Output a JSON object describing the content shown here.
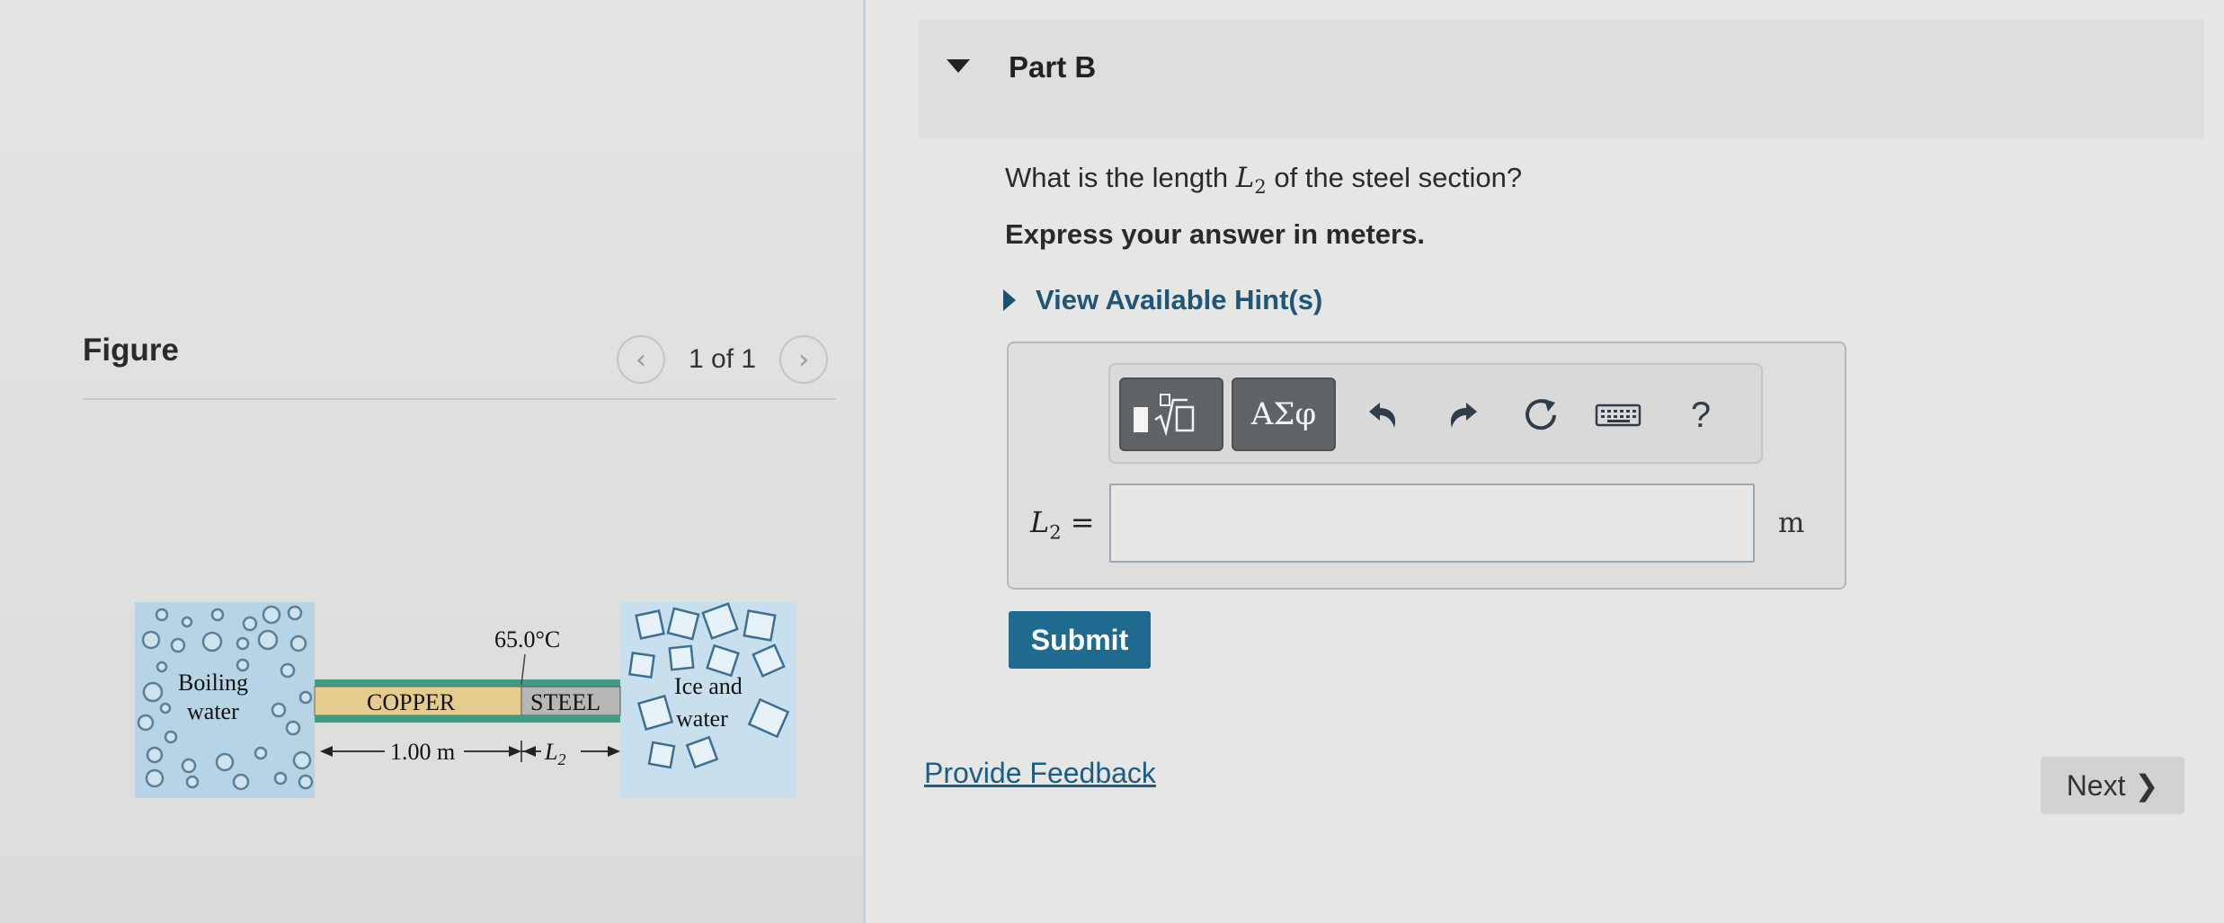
{
  "figure": {
    "title": "Figure",
    "pager_text": "1 of 1",
    "prev_icon": "chevron-left-icon",
    "next_icon": "chevron-right-icon",
    "diagram": {
      "left_reservoir_line1": "Boiling",
      "left_reservoir_line2": "water",
      "copper_label": "COPPER",
      "steel_label": "STEEL",
      "right_reservoir_line1": "Ice and",
      "right_reservoir_line2": "water",
      "junction_temp": "65.0°C",
      "copper_length": "1.00 m",
      "steel_length_symbol": "L",
      "steel_length_sub": "2"
    }
  },
  "part": {
    "title": "Part B",
    "question_before": "What is the length ",
    "question_symbol": "L",
    "question_sub": "2",
    "question_after": " of the steel section?",
    "express": "Express your answer in meters.",
    "hint_label": "View Available Hint(s)"
  },
  "toolbar": {
    "greek_label": "ΑΣφ",
    "help_label": "?",
    "icons": [
      "templates-icon",
      "undo-icon",
      "redo-icon",
      "reset-icon",
      "keyboard-icon",
      "help-icon"
    ]
  },
  "answer": {
    "symbol": "L",
    "sub": "2",
    "equals": " =",
    "value": "",
    "unit": "m"
  },
  "actions": {
    "submit_label": "Submit",
    "feedback_label": "Provide Feedback",
    "next_label": "Next",
    "next_chevron": "❯"
  },
  "colors": {
    "submit_bg": "#1f6a8f",
    "link": "#1c5d84",
    "copper": "#e4cc8f",
    "steel": "#b5b8b5",
    "rod_stripe": "#3f9b86",
    "water": "#b9d6e8"
  }
}
